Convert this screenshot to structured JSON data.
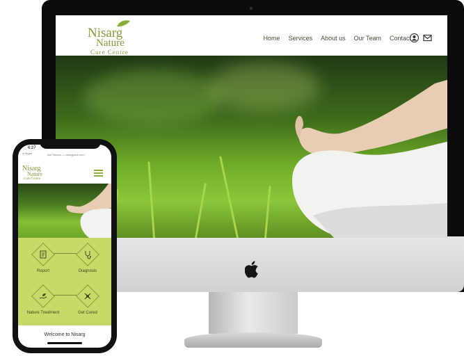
{
  "desktop": {
    "logo": {
      "line1": "Nisarg",
      "line2": "Nature",
      "line3": "Cure Centre"
    },
    "nav": [
      {
        "label": "Home"
      },
      {
        "label": "Services"
      },
      {
        "label": "About us"
      },
      {
        "label": "Our Team"
      },
      {
        "label": "Contact"
      }
    ],
    "icons": [
      "user-icon",
      "mail-icon"
    ]
  },
  "mobile": {
    "status_time": "6:27",
    "status_back": "◂ Skype",
    "url_text": "Not Secure — nisargcure.com",
    "logo": {
      "line1": "Nisarg",
      "line2": "Nature",
      "line3": "Cure Centre"
    },
    "features": [
      {
        "label": "Report",
        "icon": "report-icon"
      },
      {
        "label": "Diagnosis",
        "icon": "stethoscope-icon"
      },
      {
        "label": "Nature Treatment",
        "icon": "hand-leaf-icon"
      },
      {
        "label": "Get Cured",
        "icon": "hand-cured-icon"
      }
    ],
    "welcome": "Welcome to Nisarg"
  },
  "colors": {
    "brand": "#8a9a3a",
    "feature_bg": "#c8d869"
  }
}
